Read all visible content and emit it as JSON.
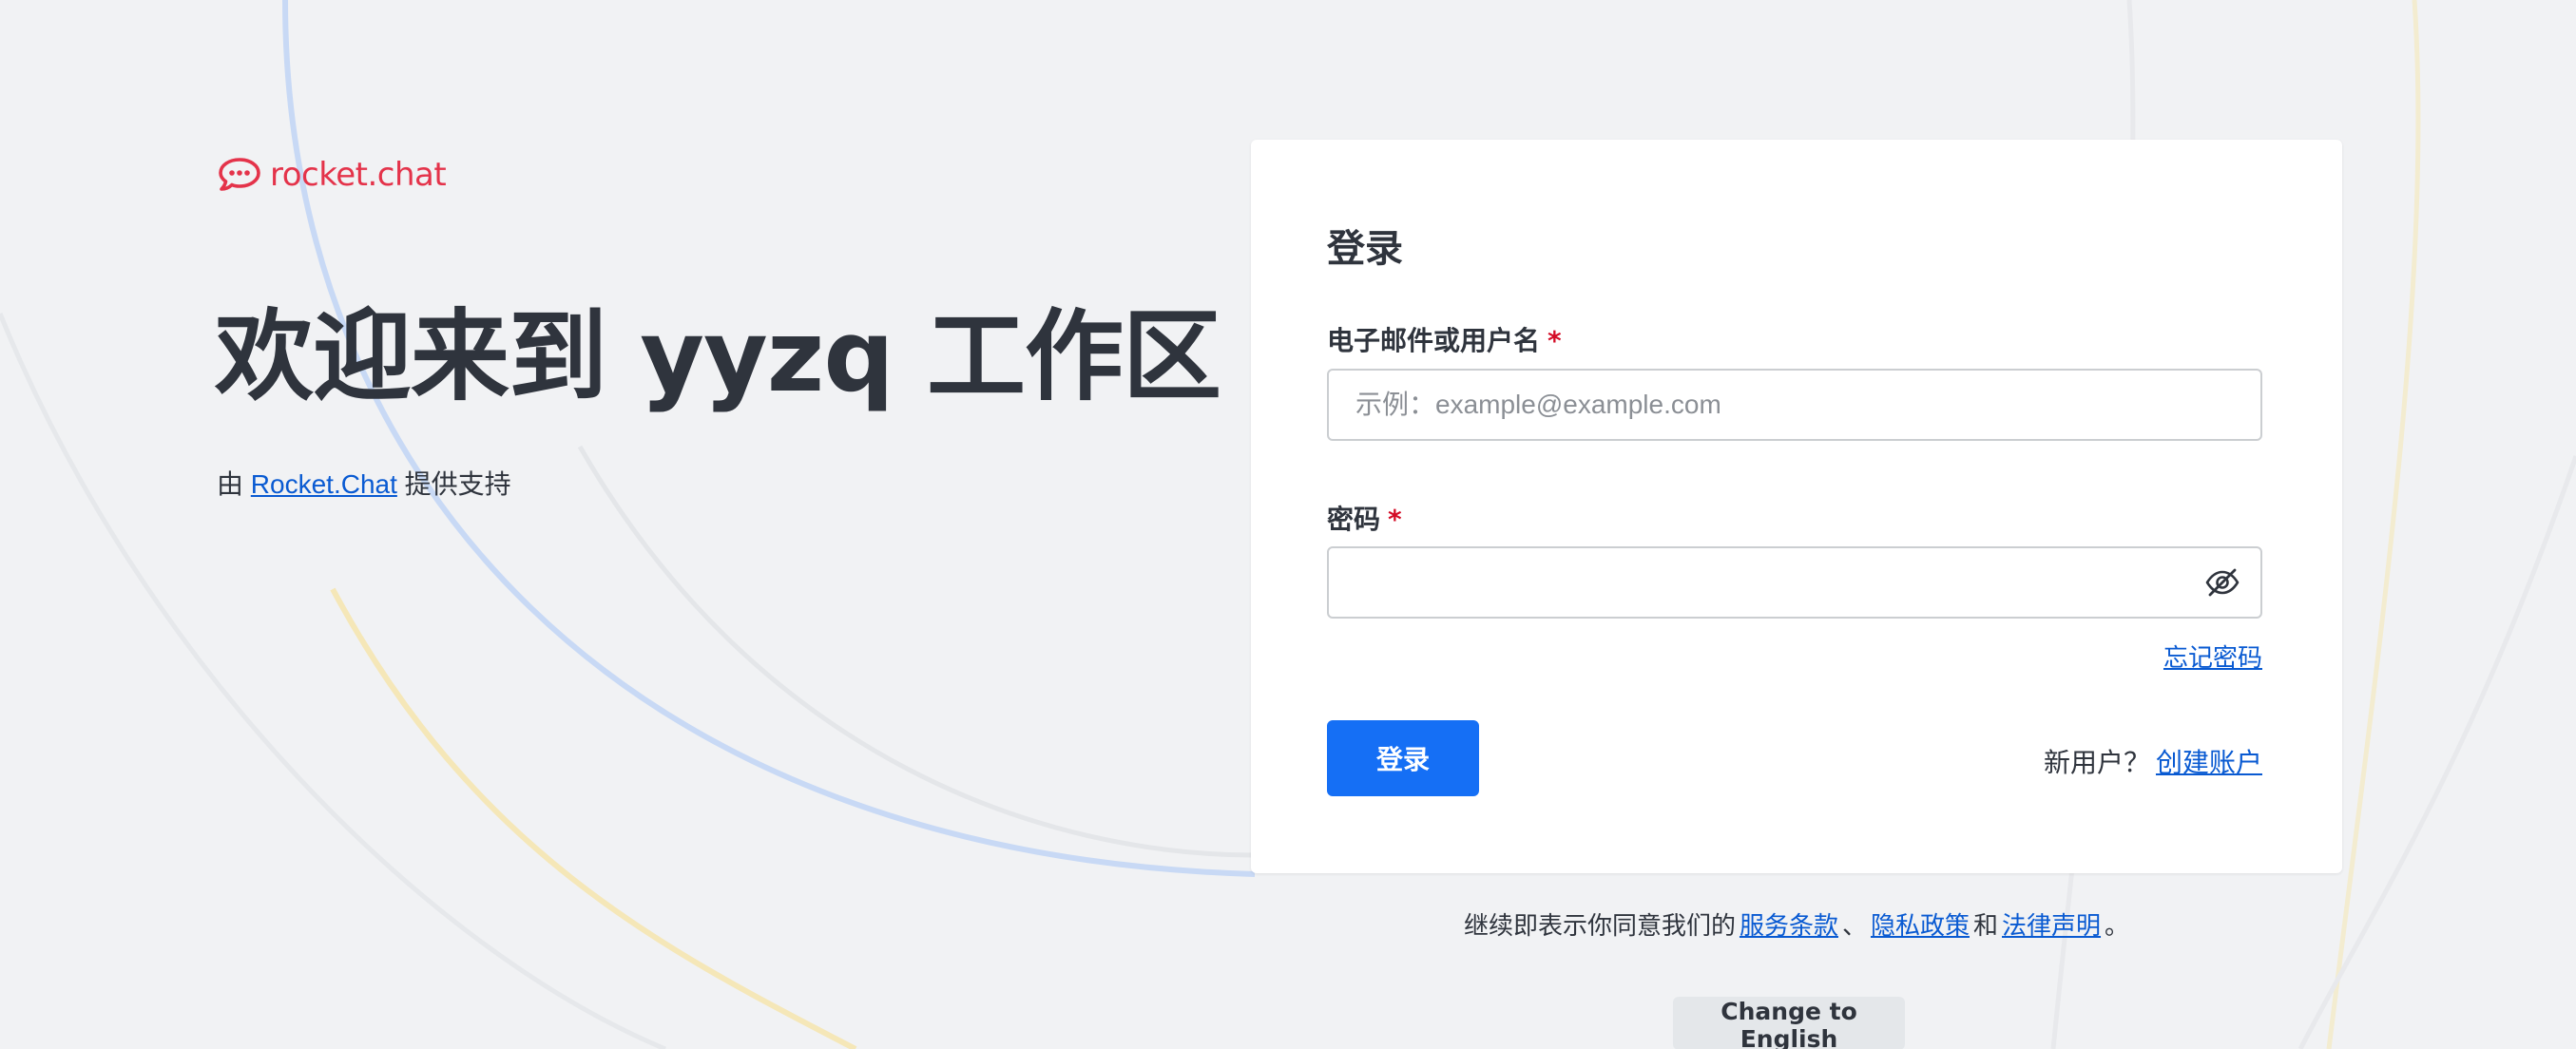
{
  "brand": {
    "logo_icon": "rocket-chat-logo-icon",
    "name": "rocket.chat",
    "color": "#e4334a"
  },
  "hero": {
    "title": "欢迎来到 yyzq 工作区",
    "powered_prefix": "由",
    "powered_link": "Rocket.Chat",
    "powered_suffix": "提供支持"
  },
  "login": {
    "title": "登录",
    "email_label": "电子邮件或用户名",
    "email_placeholder": "示例：example@example.com",
    "email_value": "",
    "password_label": "密码",
    "password_value": "",
    "required_mark": "*",
    "toggle_icon": "eye-off-icon",
    "forgot_password": "忘记密码",
    "submit_label": "登录",
    "new_user_text": "新用户？",
    "create_account": "创建账户"
  },
  "footer": {
    "terms_prefix": "继续即表示你同意我们的",
    "terms_of_service": "服务条款",
    "separator": "、",
    "privacy_policy": "隐私政策",
    "and": "和",
    "legal_notice": "法律声明",
    "period": "。",
    "change_language": "Change to English"
  },
  "colors": {
    "primary": "#156ff5",
    "link": "#095ad2",
    "required": "#d40c26",
    "background": "#f1f2f4"
  }
}
